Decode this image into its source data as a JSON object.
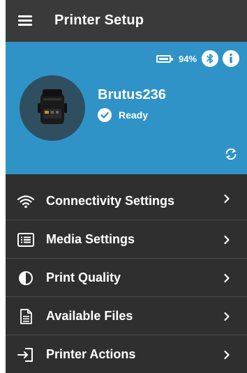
{
  "app_bar": {
    "title": "Printer Setup",
    "menu_icon": "hamburger-menu-icon"
  },
  "status_card": {
    "background_color": "#2f93c7",
    "battery_percent": "94%",
    "printer_name": "Brutus236",
    "status_text": "Ready",
    "icons": [
      "battery-icon",
      "bluetooth-icon",
      "info-icon",
      "check-circle-icon",
      "refresh-icon"
    ]
  },
  "menu": {
    "items": [
      {
        "label": "Connectivity Settings",
        "icon": "wifi-icon"
      },
      {
        "label": "Media Settings",
        "icon": "list-icon"
      },
      {
        "label": "Print Quality",
        "icon": "contrast-icon"
      },
      {
        "label": "Available Files",
        "icon": "file-icon"
      },
      {
        "label": "Printer Actions",
        "icon": "login-arrow-icon"
      }
    ]
  }
}
